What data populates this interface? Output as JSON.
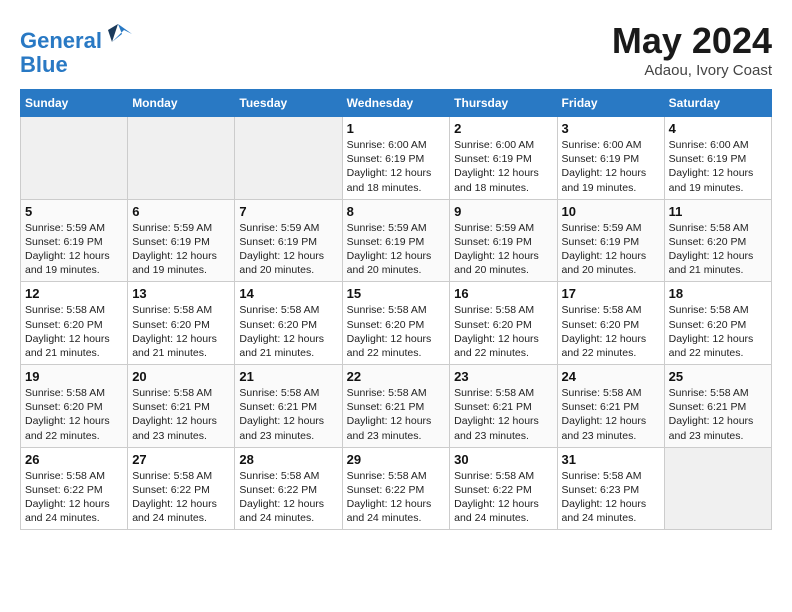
{
  "header": {
    "logo_line1": "General",
    "logo_line2": "Blue",
    "title": "May 2024",
    "location": "Adaou, Ivory Coast"
  },
  "days_of_week": [
    "Sunday",
    "Monday",
    "Tuesday",
    "Wednesday",
    "Thursday",
    "Friday",
    "Saturday"
  ],
  "weeks": [
    [
      {
        "num": "",
        "empty": true
      },
      {
        "num": "",
        "empty": true
      },
      {
        "num": "",
        "empty": true
      },
      {
        "num": "1",
        "sunrise": "6:00 AM",
        "sunset": "6:19 PM",
        "daylight": "12 hours and 18 minutes."
      },
      {
        "num": "2",
        "sunrise": "6:00 AM",
        "sunset": "6:19 PM",
        "daylight": "12 hours and 18 minutes."
      },
      {
        "num": "3",
        "sunrise": "6:00 AM",
        "sunset": "6:19 PM",
        "daylight": "12 hours and 19 minutes."
      },
      {
        "num": "4",
        "sunrise": "6:00 AM",
        "sunset": "6:19 PM",
        "daylight": "12 hours and 19 minutes."
      }
    ],
    [
      {
        "num": "5",
        "sunrise": "5:59 AM",
        "sunset": "6:19 PM",
        "daylight": "12 hours and 19 minutes."
      },
      {
        "num": "6",
        "sunrise": "5:59 AM",
        "sunset": "6:19 PM",
        "daylight": "12 hours and 19 minutes."
      },
      {
        "num": "7",
        "sunrise": "5:59 AM",
        "sunset": "6:19 PM",
        "daylight": "12 hours and 20 minutes."
      },
      {
        "num": "8",
        "sunrise": "5:59 AM",
        "sunset": "6:19 PM",
        "daylight": "12 hours and 20 minutes."
      },
      {
        "num": "9",
        "sunrise": "5:59 AM",
        "sunset": "6:19 PM",
        "daylight": "12 hours and 20 minutes."
      },
      {
        "num": "10",
        "sunrise": "5:59 AM",
        "sunset": "6:19 PM",
        "daylight": "12 hours and 20 minutes."
      },
      {
        "num": "11",
        "sunrise": "5:58 AM",
        "sunset": "6:20 PM",
        "daylight": "12 hours and 21 minutes."
      }
    ],
    [
      {
        "num": "12",
        "sunrise": "5:58 AM",
        "sunset": "6:20 PM",
        "daylight": "12 hours and 21 minutes."
      },
      {
        "num": "13",
        "sunrise": "5:58 AM",
        "sunset": "6:20 PM",
        "daylight": "12 hours and 21 minutes."
      },
      {
        "num": "14",
        "sunrise": "5:58 AM",
        "sunset": "6:20 PM",
        "daylight": "12 hours and 21 minutes."
      },
      {
        "num": "15",
        "sunrise": "5:58 AM",
        "sunset": "6:20 PM",
        "daylight": "12 hours and 22 minutes."
      },
      {
        "num": "16",
        "sunrise": "5:58 AM",
        "sunset": "6:20 PM",
        "daylight": "12 hours and 22 minutes."
      },
      {
        "num": "17",
        "sunrise": "5:58 AM",
        "sunset": "6:20 PM",
        "daylight": "12 hours and 22 minutes."
      },
      {
        "num": "18",
        "sunrise": "5:58 AM",
        "sunset": "6:20 PM",
        "daylight": "12 hours and 22 minutes."
      }
    ],
    [
      {
        "num": "19",
        "sunrise": "5:58 AM",
        "sunset": "6:20 PM",
        "daylight": "12 hours and 22 minutes."
      },
      {
        "num": "20",
        "sunrise": "5:58 AM",
        "sunset": "6:21 PM",
        "daylight": "12 hours and 23 minutes."
      },
      {
        "num": "21",
        "sunrise": "5:58 AM",
        "sunset": "6:21 PM",
        "daylight": "12 hours and 23 minutes."
      },
      {
        "num": "22",
        "sunrise": "5:58 AM",
        "sunset": "6:21 PM",
        "daylight": "12 hours and 23 minutes."
      },
      {
        "num": "23",
        "sunrise": "5:58 AM",
        "sunset": "6:21 PM",
        "daylight": "12 hours and 23 minutes."
      },
      {
        "num": "24",
        "sunrise": "5:58 AM",
        "sunset": "6:21 PM",
        "daylight": "12 hours and 23 minutes."
      },
      {
        "num": "25",
        "sunrise": "5:58 AM",
        "sunset": "6:21 PM",
        "daylight": "12 hours and 23 minutes."
      }
    ],
    [
      {
        "num": "26",
        "sunrise": "5:58 AM",
        "sunset": "6:22 PM",
        "daylight": "12 hours and 24 minutes."
      },
      {
        "num": "27",
        "sunrise": "5:58 AM",
        "sunset": "6:22 PM",
        "daylight": "12 hours and 24 minutes."
      },
      {
        "num": "28",
        "sunrise": "5:58 AM",
        "sunset": "6:22 PM",
        "daylight": "12 hours and 24 minutes."
      },
      {
        "num": "29",
        "sunrise": "5:58 AM",
        "sunset": "6:22 PM",
        "daylight": "12 hours and 24 minutes."
      },
      {
        "num": "30",
        "sunrise": "5:58 AM",
        "sunset": "6:22 PM",
        "daylight": "12 hours and 24 minutes."
      },
      {
        "num": "31",
        "sunrise": "5:58 AM",
        "sunset": "6:23 PM",
        "daylight": "12 hours and 24 minutes."
      },
      {
        "num": "",
        "empty": true
      }
    ]
  ]
}
